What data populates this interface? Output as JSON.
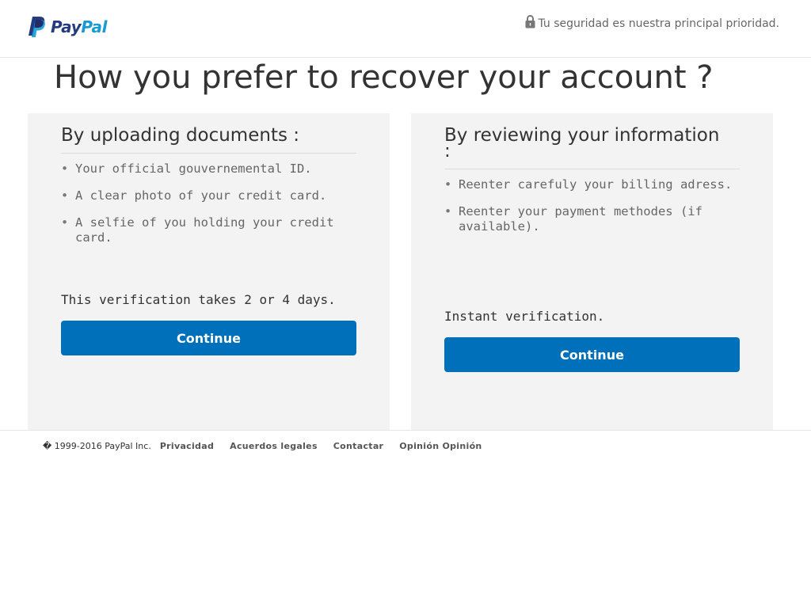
{
  "header": {
    "logo_pay": "Pay",
    "logo_pal": "Pal",
    "security_text": "Tu seguridad es nuestra principal prioridad.",
    "logo_icon": "paypal-p-icon",
    "security_icon": "lock-icon"
  },
  "main": {
    "title": "How you prefer to recover your account ?"
  },
  "panels": [
    {
      "title_line1": "By uploading documents :",
      "title_line2": "",
      "items": [
        "Your official gouvernemental ID.",
        "A clear photo of your credit card.",
        "A selfie of you holding your credit card."
      ],
      "note": "This verification takes 2 or 4 days.",
      "button": "Continue"
    },
    {
      "title_line1": "By reviewing your information",
      "title_line2": ":",
      "items": [
        "Reenter carefuly your billing adress.",
        "Reenter your payment methodes (if available)."
      ],
      "note": "Instant verification.",
      "button": "Continue"
    }
  ],
  "footer": {
    "copyright": "� 1999-2016 PayPal Inc.",
    "links": [
      "Privacidad",
      "Acuerdos legales",
      "Contactar",
      "Opinión Opinión"
    ]
  },
  "colors": {
    "brand_dark": "#253b80",
    "brand_light": "#179bd7",
    "button": "#0070ba",
    "panel_bg": "#f3f3f3"
  }
}
